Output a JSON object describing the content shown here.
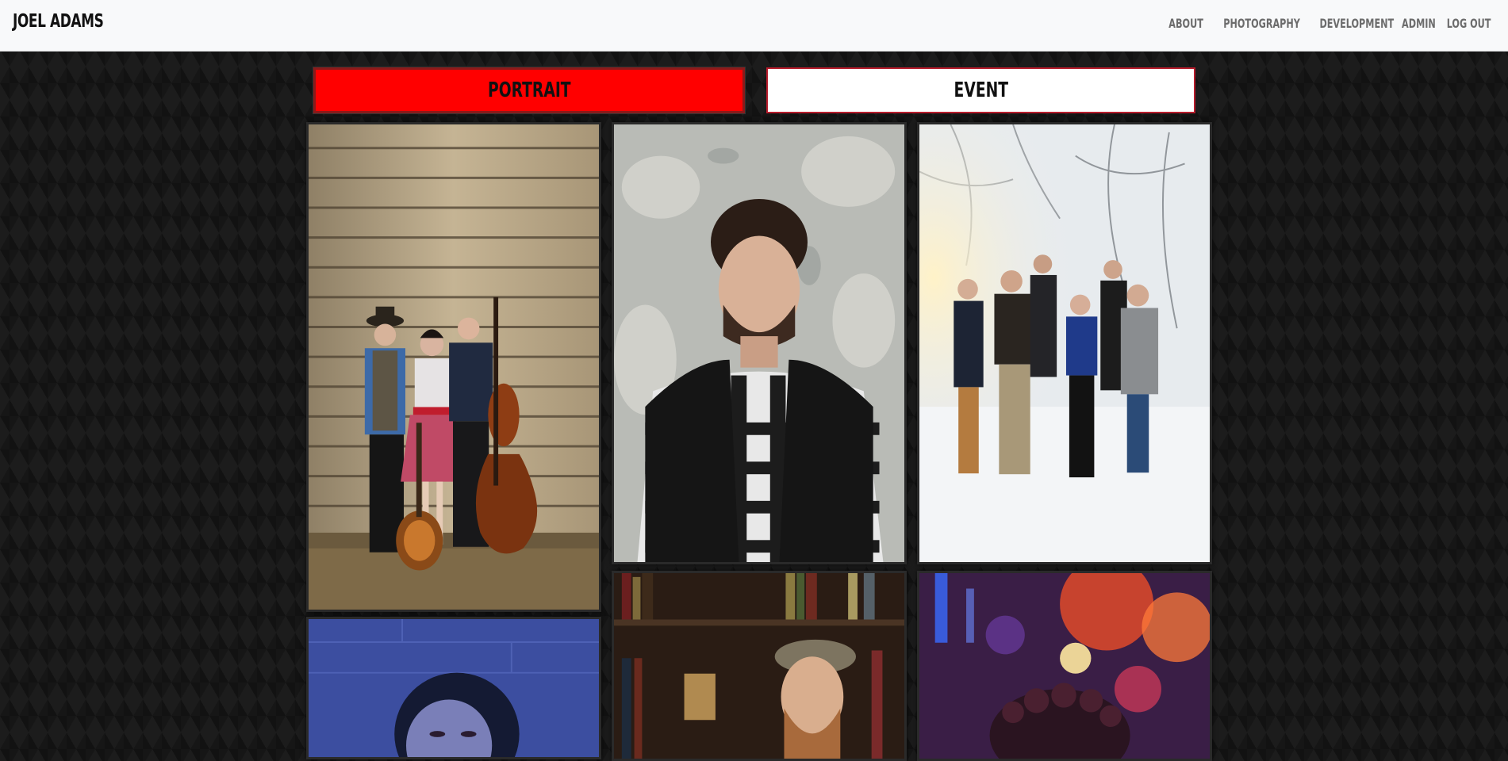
{
  "brand": "JOEL ADAMS",
  "nav": {
    "items": [
      "ABOUT",
      "PHOTOGRAPHY",
      "DEVELOPMENT",
      "ADMIN",
      "LOG OUT"
    ]
  },
  "tabs": {
    "portrait": "PORTRAIT",
    "event": "EVENT"
  },
  "colors": {
    "active_tab": "#ff0000",
    "inactive_tab": "#ffffff",
    "tab_border": "#b71c2c",
    "navbar_bg": "#f8f9fa"
  },
  "gallery": {
    "photos": [
      "band-portrait-photo",
      "bearded-man-portrait-photo",
      "family-winter-photo",
      "woman-blue-light-photo",
      "man-flat-cap-bookshelf-photo",
      "curly-hair-neon-bokeh-photo"
    ]
  }
}
